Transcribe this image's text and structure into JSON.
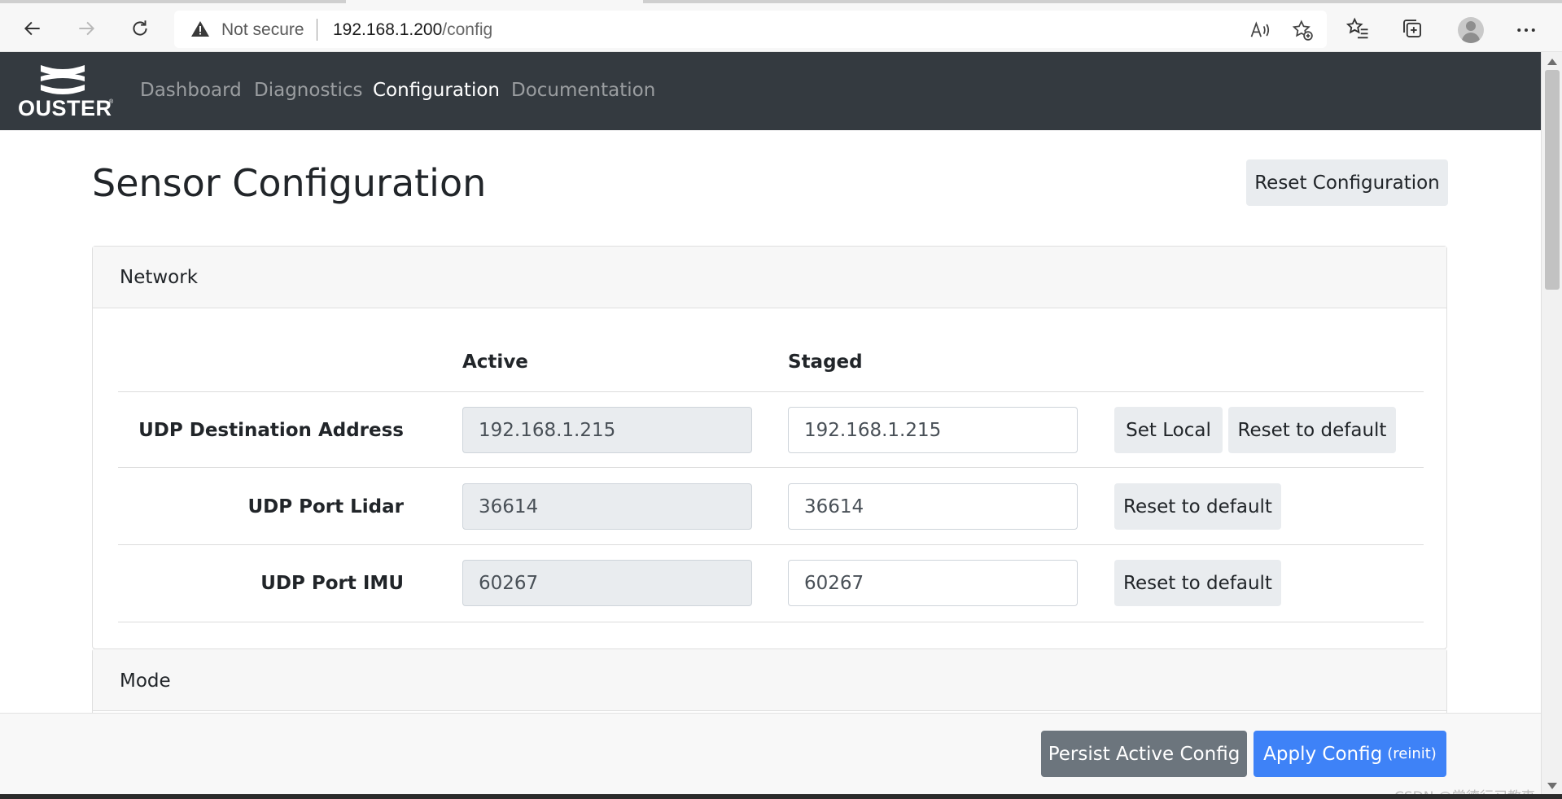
{
  "browser": {
    "not_secure_label": "Not secure",
    "url_host": "192.168.1.200",
    "url_path": "/config",
    "icons": [
      "back-icon",
      "forward-icon",
      "refresh-icon",
      "warning-icon",
      "read-aloud-icon",
      "add-favorite-icon",
      "favorites-icon",
      "collections-icon",
      "profile-icon",
      "more-icon"
    ]
  },
  "navbar": {
    "brand": "OUSTER",
    "brand_mark": "®",
    "links": [
      {
        "label": "Dashboard",
        "active": false
      },
      {
        "label": "Diagnostics",
        "active": false
      },
      {
        "label": "Configuration",
        "active": true
      },
      {
        "label": "Documentation",
        "active": false
      }
    ]
  },
  "page": {
    "title": "Sensor Configuration",
    "reset_configuration_label": "Reset Configuration"
  },
  "network": {
    "header": "Network",
    "col_active": "Active",
    "col_staged": "Staged",
    "rows": [
      {
        "label": "UDP Destination Address",
        "active": "192.168.1.215",
        "staged": "192.168.1.215",
        "set_local_label": "Set Local",
        "reset_label": "Reset to default"
      },
      {
        "label": "UDP Port Lidar",
        "active": "36614",
        "staged": "36614",
        "reset_label": "Reset to default"
      },
      {
        "label": "UDP Port IMU",
        "active": "60267",
        "staged": "60267",
        "reset_label": "Reset to default"
      }
    ]
  },
  "mode": {
    "header": "Mode"
  },
  "footer": {
    "persist_label": "Persist Active Config",
    "apply_label": "Apply Config",
    "apply_sub": "(reinit)",
    "watermark": "CSDN @常德行习教事"
  },
  "colors": {
    "navbar_bg": "#343a40",
    "primary": "#3e82f7",
    "secondary": "#6c757d",
    "light_button": "#e9ecef"
  }
}
